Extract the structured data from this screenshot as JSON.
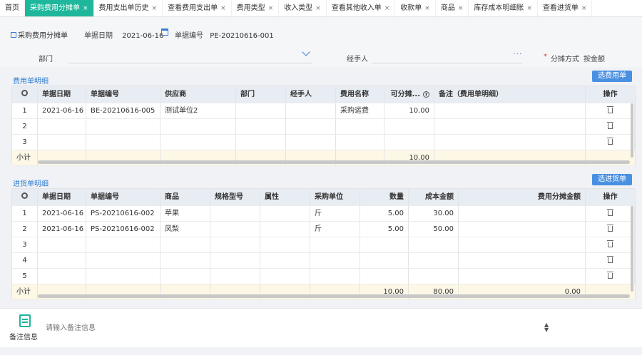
{
  "tabs": [
    {
      "label": "首页",
      "closable": false,
      "active": false
    },
    {
      "label": "采购费用分摊单",
      "closable": true,
      "active": true
    },
    {
      "label": "费用支出单历史",
      "closable": true,
      "active": false
    },
    {
      "label": "查看费用支出单",
      "closable": true,
      "active": false
    },
    {
      "label": "费用类型",
      "closable": true,
      "active": false
    },
    {
      "label": "收入类型",
      "closable": true,
      "active": false
    },
    {
      "label": "查看其他收入单",
      "closable": true,
      "active": false
    },
    {
      "label": "收款单",
      "closable": true,
      "active": false
    },
    {
      "label": "商品",
      "closable": true,
      "active": false
    },
    {
      "label": "库存成本明细账",
      "closable": true,
      "active": false
    },
    {
      "label": "查看进货单",
      "closable": true,
      "active": false
    }
  ],
  "tab_close": "×",
  "header": {
    "doc_title": "采购费用分摊单",
    "date_label": "单据日期",
    "date_value": "2021-06-16",
    "code_label": "单据编号",
    "code_value": "PE-20210616-001",
    "dept_label": "部门",
    "handler_label": "经手人",
    "handler_dots": "···",
    "alloc_required": "*",
    "alloc_label": "分摊方式",
    "alloc_value": "按金额"
  },
  "expense": {
    "section_title": "费用单明细",
    "select_button": "选费用单",
    "columns": [
      "单据日期",
      "单据编号",
      "供应商",
      "部门",
      "经手人",
      "费用名称",
      "可分摊...",
      "备注（费用单明细）",
      "操作"
    ],
    "rows": [
      {
        "no": "1",
        "date": "2021-06-16",
        "code": "BE-20210616-005",
        "supplier": "测试单位2",
        "dept": "",
        "handler": "",
        "name": "采购运费",
        "amount": "10.00",
        "remark": ""
      },
      {
        "no": "2",
        "date": "",
        "code": "",
        "supplier": "",
        "dept": "",
        "handler": "",
        "name": "",
        "amount": "",
        "remark": ""
      },
      {
        "no": "3",
        "date": "",
        "code": "",
        "supplier": "",
        "dept": "",
        "handler": "",
        "name": "",
        "amount": "",
        "remark": ""
      }
    ],
    "subtotal_label": "小计",
    "subtotal_amount": "10.00"
  },
  "purchase": {
    "section_title": "进货单明细",
    "select_button": "选进货单",
    "columns": [
      "单据日期",
      "单据编号",
      "商品",
      "规格型号",
      "属性",
      "采购单位",
      "数量",
      "成本金额",
      "费用分摊金额",
      "操作"
    ],
    "rows": [
      {
        "no": "1",
        "date": "2021-06-16",
        "code": "PS-20210616-002",
        "goods": "苹果",
        "spec": "",
        "attr": "",
        "unit": "斤",
        "qty": "5.00",
        "cost": "30.00",
        "alloc": ""
      },
      {
        "no": "2",
        "date": "2021-06-16",
        "code": "PS-20210616-002",
        "goods": "凤梨",
        "spec": "",
        "attr": "",
        "unit": "斤",
        "qty": "5.00",
        "cost": "50.00",
        "alloc": ""
      },
      {
        "no": "3",
        "date": "",
        "code": "",
        "goods": "",
        "spec": "",
        "attr": "",
        "unit": "",
        "qty": "",
        "cost": "",
        "alloc": ""
      },
      {
        "no": "4",
        "date": "",
        "code": "",
        "goods": "",
        "spec": "",
        "attr": "",
        "unit": "",
        "qty": "",
        "cost": "",
        "alloc": ""
      },
      {
        "no": "5",
        "date": "",
        "code": "",
        "goods": "",
        "spec": "",
        "attr": "",
        "unit": "",
        "qty": "",
        "cost": "",
        "alloc": ""
      }
    ],
    "subtotal_label": "小计",
    "subtotal_qty": "10.00",
    "subtotal_cost": "80.00",
    "subtotal_alloc": "0.00"
  },
  "footer": {
    "remark_label": "备注信息",
    "remark_placeholder": "请输入备注信息"
  },
  "colors": {
    "accent": "#1fb79b",
    "blue": "#4a90e2",
    "subtotal_bg": "#fdf7e6"
  }
}
